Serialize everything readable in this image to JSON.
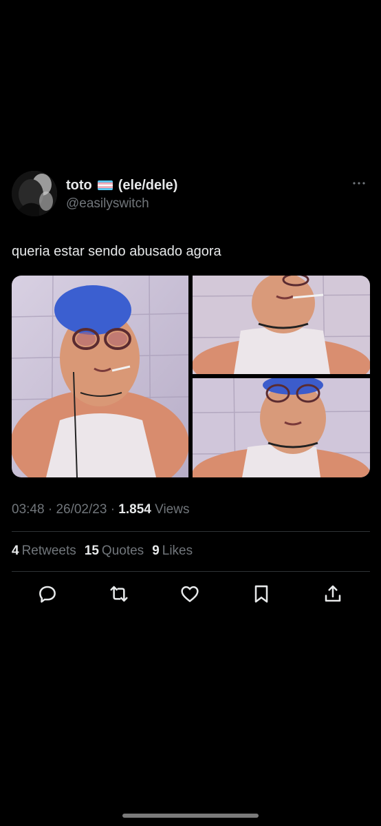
{
  "tweet": {
    "display_name": "toto",
    "pronouns": "(ele/dele)",
    "handle": "@easilyswitch",
    "flag": "transgender-flag",
    "text": "queria estar sendo abusado agora",
    "time": "03:48",
    "separator": "·",
    "date": "26/02/23",
    "views_count": "1.854",
    "views_label": "Views"
  },
  "stats": {
    "retweets_count": "4",
    "retweets_label": "Retweets",
    "quotes_count": "15",
    "quotes_label": "Quotes",
    "likes_count": "9",
    "likes_label": "Likes"
  },
  "icons": {
    "more": "more-horizontal-icon",
    "reply": "reply-icon",
    "retweet": "retweet-icon",
    "like": "heart-icon",
    "bookmark": "bookmark-icon",
    "share": "share-icon"
  },
  "colors": {
    "background": "#000000",
    "primary_text": "#e7e9ea",
    "secondary_text": "#71767b",
    "divider": "#2f3336"
  }
}
